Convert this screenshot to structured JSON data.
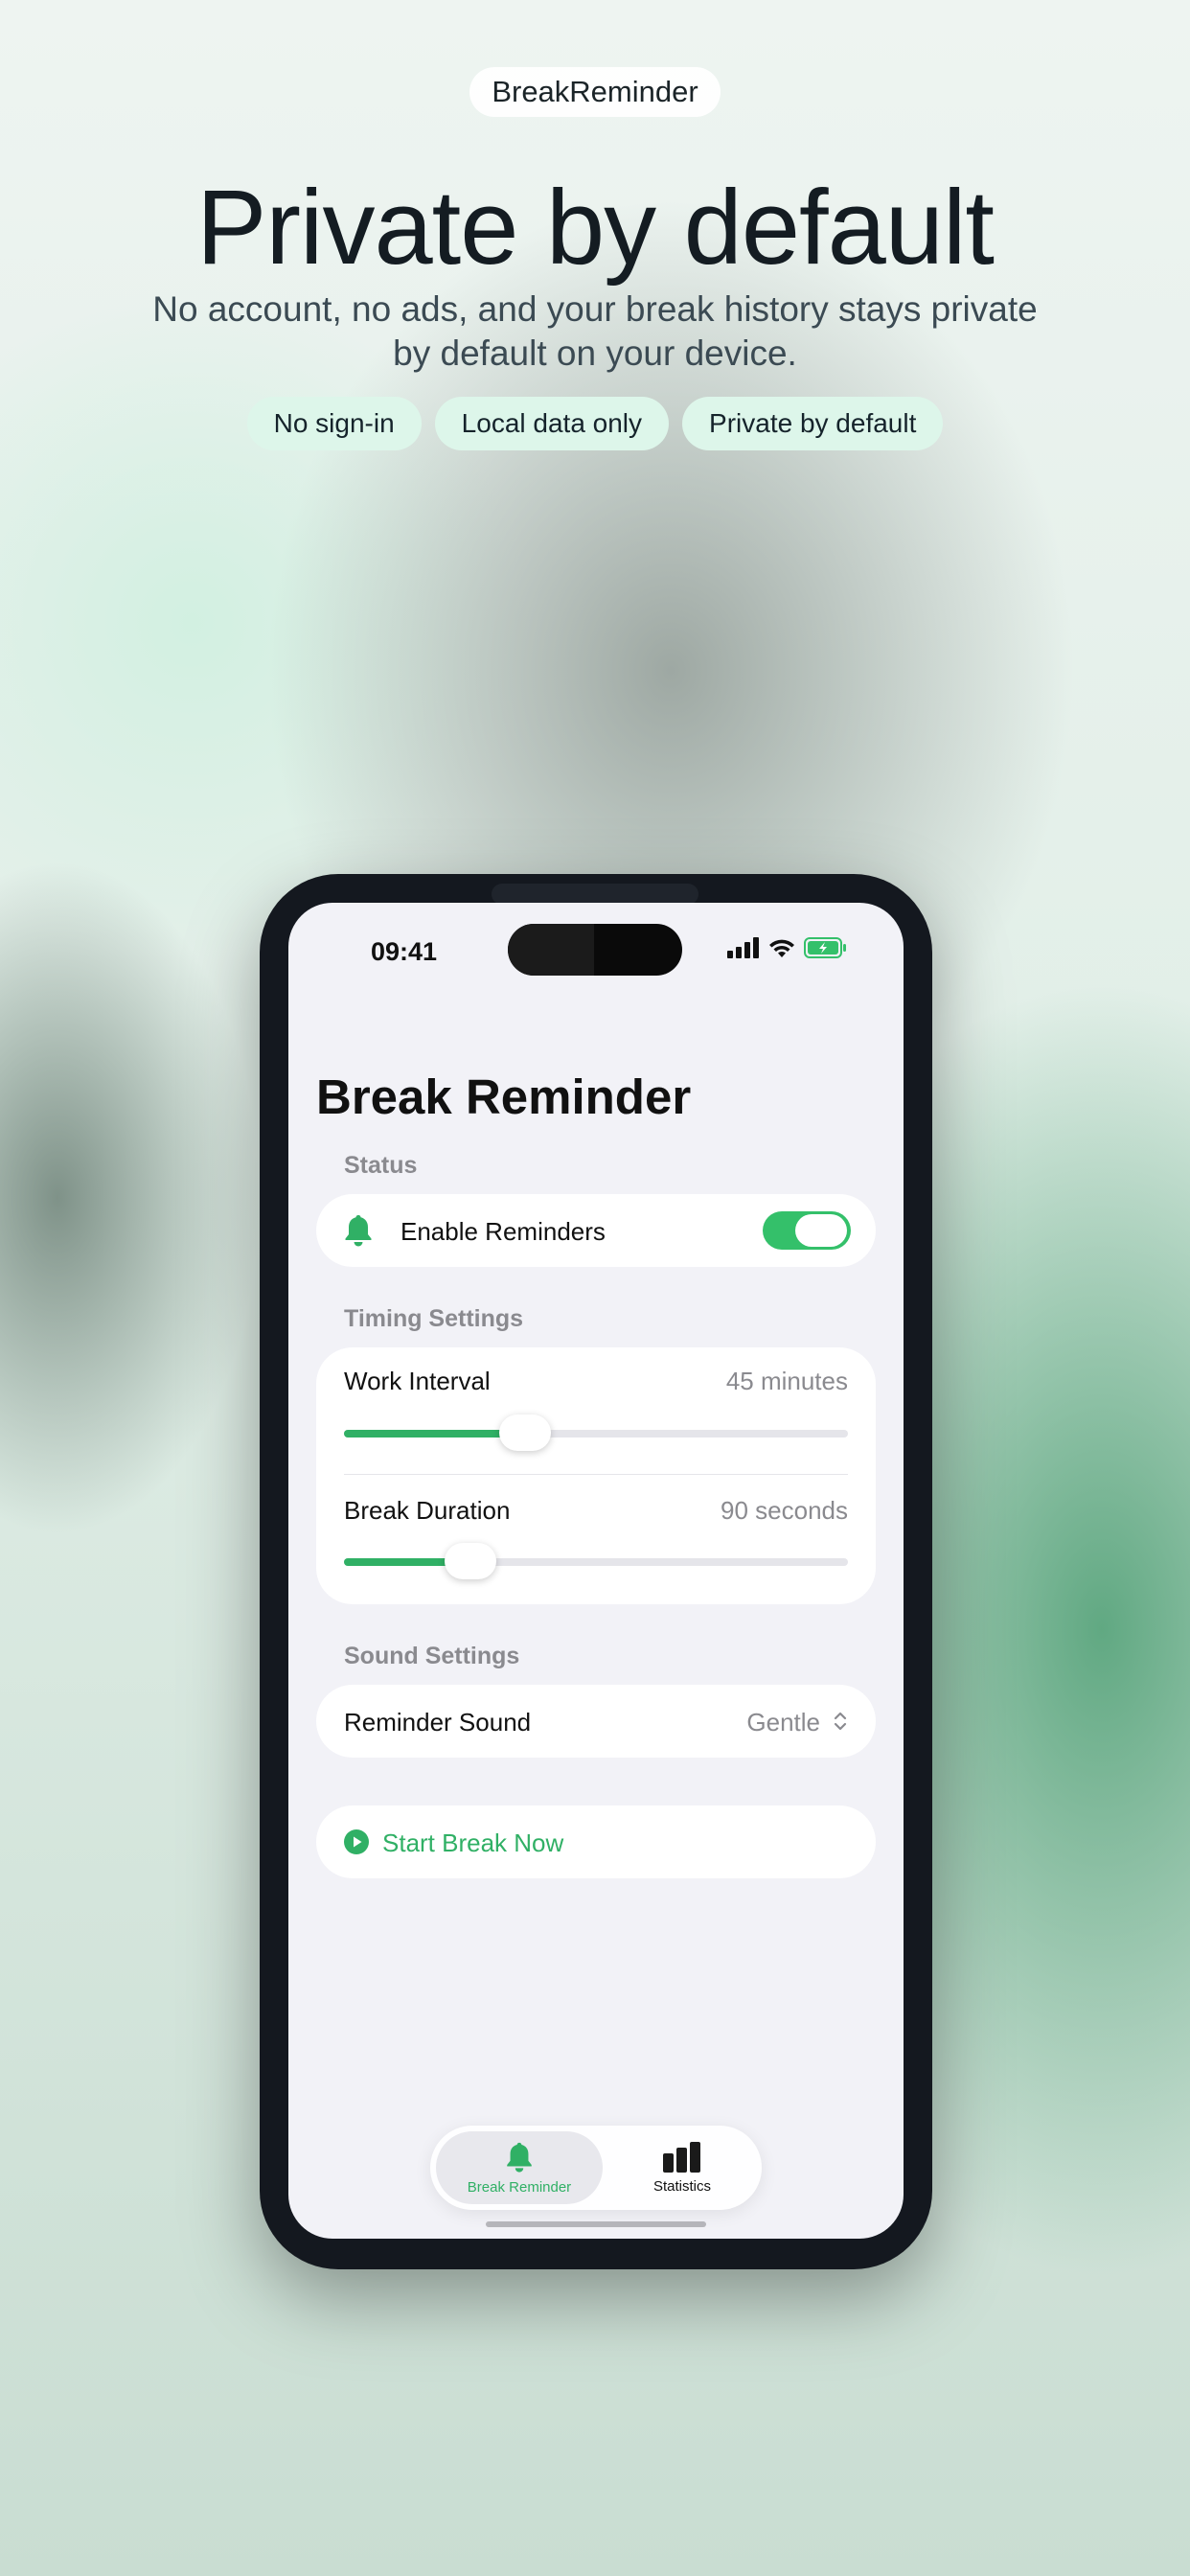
{
  "header": {
    "app_name": "BreakReminder",
    "headline": "Private by default",
    "subheadline": "No account, no ads, and your break history stays private by default on your device.",
    "chips": [
      "No sign-in",
      "Local data only",
      "Private by default"
    ]
  },
  "status_bar": {
    "time": "09:41"
  },
  "screen": {
    "title": "Break Reminder",
    "status_section": {
      "label": "Status",
      "enable_reminders": {
        "label": "Enable Reminders",
        "on": true,
        "icon": "bell-icon"
      }
    },
    "timing_section": {
      "label": "Timing Settings",
      "work_interval": {
        "label": "Work Interval",
        "value": "45 minutes",
        "slider_fraction": 0.36
      },
      "break_duration": {
        "label": "Break Duration",
        "value": "90 seconds",
        "slider_fraction": 0.25
      }
    },
    "sound_section": {
      "label": "Sound Settings",
      "reminder_sound": {
        "label": "Reminder Sound",
        "value": "Gentle",
        "icon": "chevron-updown-icon"
      }
    },
    "start_break": {
      "label": "Start Break Now",
      "icon": "play-circle-icon"
    }
  },
  "tab_bar": {
    "tabs": [
      {
        "label": "Break Reminder",
        "icon": "bell-icon",
        "selected": true
      },
      {
        "label": "Statistics",
        "icon": "bar-chart-icon",
        "selected": false
      }
    ]
  },
  "colors": {
    "accent": "#30b065",
    "toggle_on": "#34c06a",
    "chip_bg": "#ddf6ea",
    "phone_frame": "#14181f",
    "screen_bg": "#f2f2f7"
  }
}
